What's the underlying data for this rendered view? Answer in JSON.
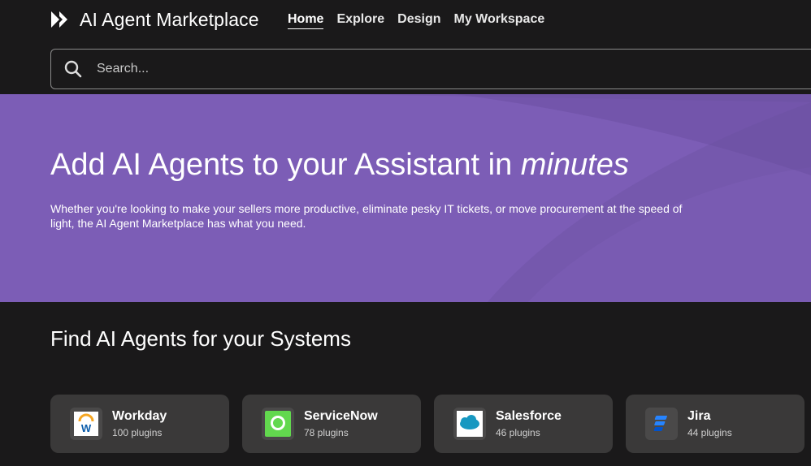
{
  "header": {
    "title": "AI Agent Marketplace",
    "logo_icon": "double-chevron-logo-icon",
    "nav": [
      {
        "label": "Home",
        "active": true
      },
      {
        "label": "Explore",
        "active": false
      },
      {
        "label": "Design",
        "active": false
      },
      {
        "label": "My Workspace",
        "active": false
      }
    ]
  },
  "search": {
    "placeholder": "Search...",
    "icon": "search-icon"
  },
  "hero": {
    "title_main": "Add AI Agents to your Assistant in ",
    "title_emphasis": "minutes",
    "subtitle": "Whether you're looking to make your sellers more productive, eliminate pesky IT tickets, or move procurement at the speed of light, the AI Agent Marketplace has what you need.",
    "background_color": "#7c5db6"
  },
  "systems": {
    "heading": "Find AI Agents for your Systems",
    "cards": [
      {
        "name": "Workday",
        "count": "100 plugins",
        "icon": "workday-logo-icon"
      },
      {
        "name": "ServiceNow",
        "count": "78 plugins",
        "icon": "servicenow-logo-icon"
      },
      {
        "name": "Salesforce",
        "count": "46 plugins",
        "icon": "salesforce-logo-icon"
      },
      {
        "name": "Jira",
        "count": "44 plugins",
        "icon": "jira-logo-icon"
      }
    ]
  },
  "colors": {
    "background": "#1a191a",
    "card": "#3a3939",
    "hero": "#7c5db6"
  }
}
